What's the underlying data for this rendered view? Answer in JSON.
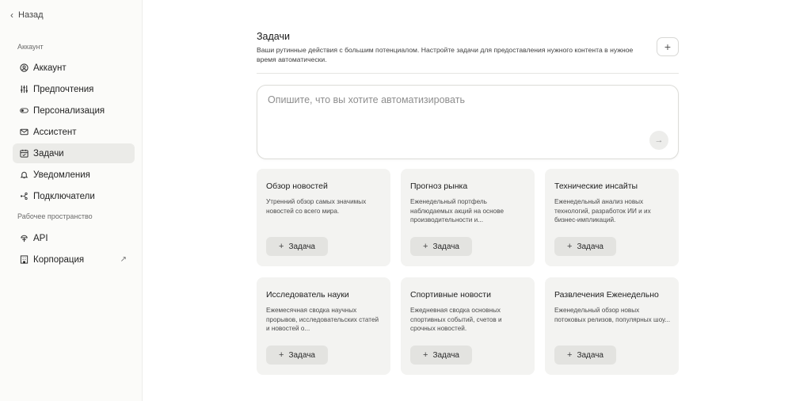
{
  "sidebar": {
    "back_label": "Назад",
    "account_section": "Аккаунт",
    "workspace_section": "Рабочее пространство",
    "items": [
      {
        "label": "Аккаунт",
        "icon": "account-circle-icon"
      },
      {
        "label": "Предпочтения",
        "icon": "sliders-icon"
      },
      {
        "label": "Персонализация",
        "icon": "toggle-icon"
      },
      {
        "label": "Ассистент",
        "icon": "mail-icon"
      },
      {
        "label": "Задачи",
        "icon": "tasks-calendar-icon",
        "active": true
      },
      {
        "label": "Уведомления",
        "icon": "bell-icon"
      },
      {
        "label": "Подключатели",
        "icon": "connectors-icon"
      },
      {
        "label": "API",
        "icon": "api-icon"
      },
      {
        "label": "Корпорация",
        "icon": "building-icon",
        "external": "↗"
      }
    ]
  },
  "main": {
    "title": "Задачи",
    "description": "Ваши рутинные действия с большим потенциалом. Настройте задачи для предоставления нужного контента в нужное время автоматически.",
    "add_button": "+",
    "prompt": {
      "value": "",
      "placeholder": "Опишите, что вы хотите автоматизировать",
      "send_icon": "→"
    },
    "cards": [
      {
        "title": "Обзор новостей",
        "desc": "Утренний обзор самых значимых новостей со всего мира.",
        "button": "Задача"
      },
      {
        "title": "Прогноз рынка",
        "desc": "Еженедельный портфель наблюдаемых акций на основе производительности и...",
        "button": "Задача"
      },
      {
        "title": "Технические инсайты",
        "desc": "Еженедельный анализ новых технологий, разработок ИИ и их бизнес-импликаций.",
        "button": "Задача"
      },
      {
        "title": "Исследователь науки",
        "desc": "Ежемесячная сводка научных прорывов, исследовательских статей и новостей о...",
        "button": "Задача"
      },
      {
        "title": "Спортивные новости",
        "desc": "Ежедневная сводка основных спортивных событий, счетов и срочных новостей.",
        "button": "Задача"
      },
      {
        "title": "Развлечения Еженедельно",
        "desc": "Еженедельный обзор новых потоковых релизов, популярных шоу...",
        "button": "Задача"
      }
    ]
  },
  "colors": {
    "sidebar_bg": "#fbfbf9",
    "card_bg": "#f3f3f1",
    "active_item_bg": "#ebebe8",
    "card_button_bg": "#e3e3e0"
  }
}
